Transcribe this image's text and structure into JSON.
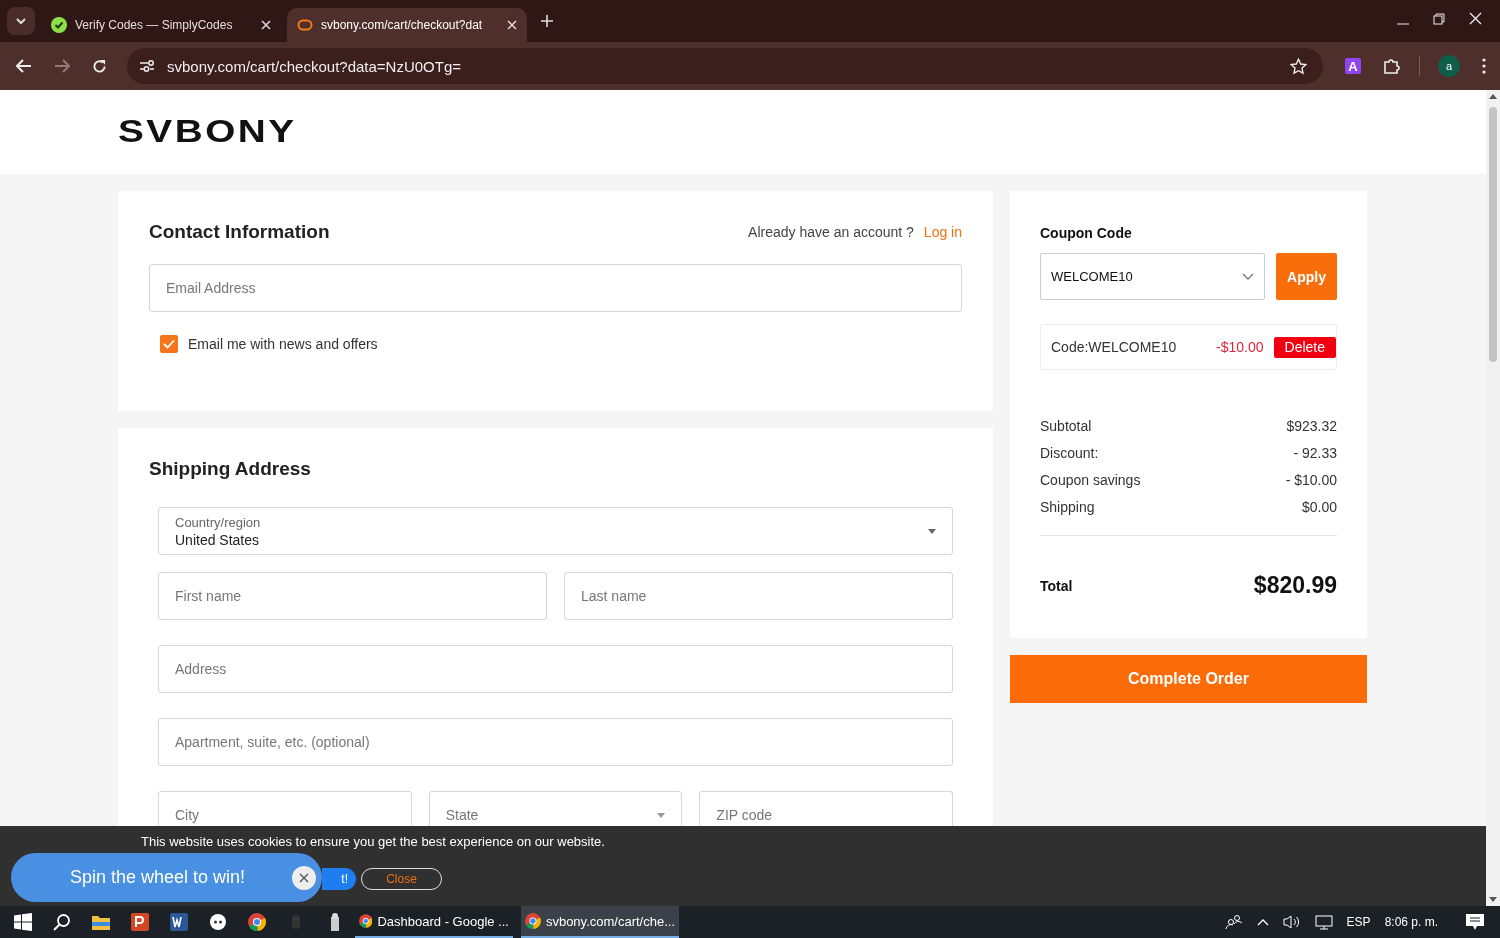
{
  "browser": {
    "tabs": [
      {
        "title": "Verify Codes — SimplyCodes",
        "selected": false
      },
      {
        "title": "svbony.com/cart/checkout?dat",
        "selected": true
      }
    ],
    "nav": [
      {
        "kind": "back",
        "disabled": false
      },
      {
        "kind": "forward",
        "disabled": true
      },
      {
        "kind": "reload",
        "disabled": false
      }
    ],
    "url": "svbony.com/cart/checkout?data=NzU0OTg=",
    "extension_letter": "A",
    "profile_letter": "a"
  },
  "logo": "SVBONY",
  "contact": {
    "title": "Contact Information",
    "account_prompt": "Already have an account ?",
    "login_link": "Log in",
    "email_placeholder": "Email Address",
    "newsletter": {
      "label": "Email me with news and offers",
      "checked": true
    }
  },
  "shipping": {
    "title": "Shipping Address",
    "country_label": "Country/region",
    "country_value": "United States",
    "fields": [
      {
        "placeholder": "First name"
      },
      {
        "placeholder": "Last name"
      }
    ],
    "address_placeholder": "Address",
    "apartment_placeholder": "Apartment, suite, etc. (optional)",
    "city_placeholder": "City",
    "state_placeholder": "State",
    "zip_placeholder": "ZIP code"
  },
  "coupon": {
    "title": "Coupon Code",
    "value": "WELCOME10",
    "apply": "Apply",
    "applied_code": "Code:WELCOME10",
    "applied_amount": "-$10.00",
    "delete": "Delete"
  },
  "summary": [
    {
      "label": "Subtotal",
      "value": "$923.32"
    },
    {
      "label": "Discount:",
      "value": "- 92.33"
    },
    {
      "label": "Coupon savings",
      "value": "- $10.00"
    },
    {
      "label": "Shipping",
      "value": "$0.00"
    }
  ],
  "total": {
    "label": "Total",
    "value": "$820.99"
  },
  "complete_order": "Complete Order",
  "cookie": {
    "text": "This website uses cookies to ensure you get the best experience on our website.",
    "accept": "t!",
    "close": "Close"
  },
  "spin": {
    "text": "Spin the wheel to win!"
  },
  "taskbar": {
    "tasks": [
      {
        "title": "Dashboard - Google ...",
        "selected": false
      },
      {
        "title": "svbony.com/cart/che...",
        "selected": true
      }
    ],
    "language": "ESP",
    "time": "8:06 p. m."
  }
}
